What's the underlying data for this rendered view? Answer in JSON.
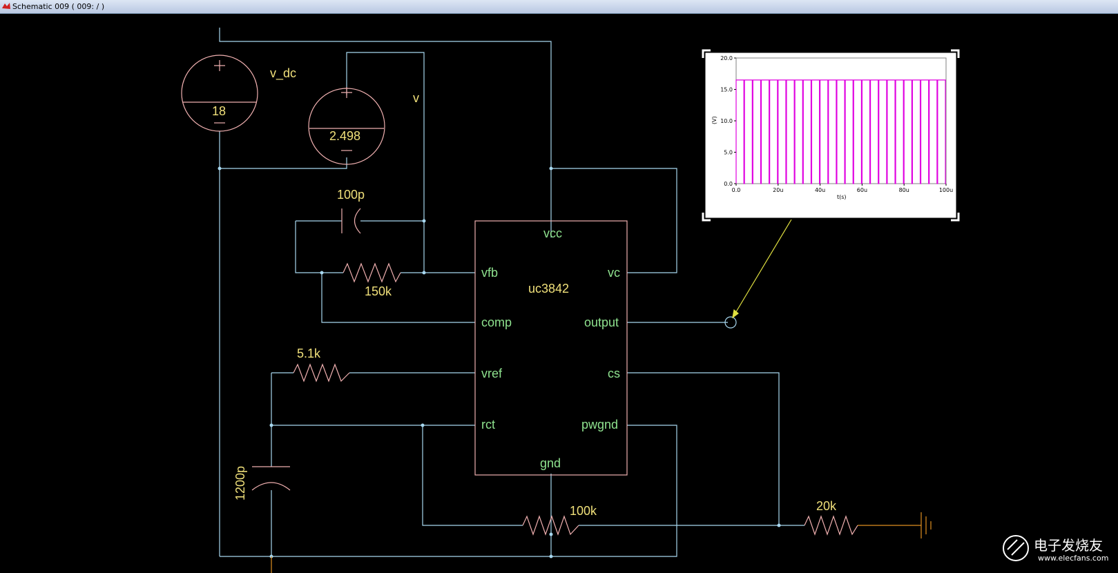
{
  "window": {
    "title": "Schematic 009 ( 009: / )"
  },
  "sources": {
    "v_dc": {
      "name": "v_dc",
      "value": "18"
    },
    "v": {
      "name": "v",
      "value": "2.498"
    }
  },
  "chip": {
    "name": "uc3842",
    "pins": {
      "vcc": "vcc",
      "vfb": "vfb",
      "vc": "vc",
      "comp": "comp",
      "output": "output",
      "vref": "vref",
      "cs": "cs",
      "rct": "rct",
      "pwgnd": "pwgnd",
      "gnd": "gnd"
    }
  },
  "components": {
    "c_fb": "100p",
    "r_fb": "150k",
    "r_ref": "5.1k",
    "c_t": "1200p",
    "r_gnd": "100k",
    "r_cs": "20k"
  },
  "probe": {
    "y_unit": "(V)",
    "x_label": "t(s)",
    "y_ticks": [
      "20.0",
      "15.0",
      "10.0",
      "5.0",
      "0.0"
    ],
    "x_ticks": [
      "0.0",
      "20u",
      "40u",
      "60u",
      "80u",
      "100u"
    ]
  },
  "chart_data": {
    "type": "line",
    "xlabel": "t(s)",
    "ylabel": "(V)",
    "xlim": [
      0,
      100
    ],
    "ylim": [
      0,
      20
    ],
    "series": [
      {
        "pulse_high": 16.5,
        "pulse_low": 0,
        "pulse_count": 25
      }
    ],
    "color": "#e000e0"
  },
  "watermark": {
    "text": "电子发烧友",
    "url": "www.elecfans.com"
  },
  "colors": {
    "wire": "#a8d8f0",
    "component": "#f0b0b0",
    "pin": "#8fe38f",
    "value": "#f0e07a",
    "probe_arrow": "#e0e040",
    "ground": "#e09020"
  }
}
